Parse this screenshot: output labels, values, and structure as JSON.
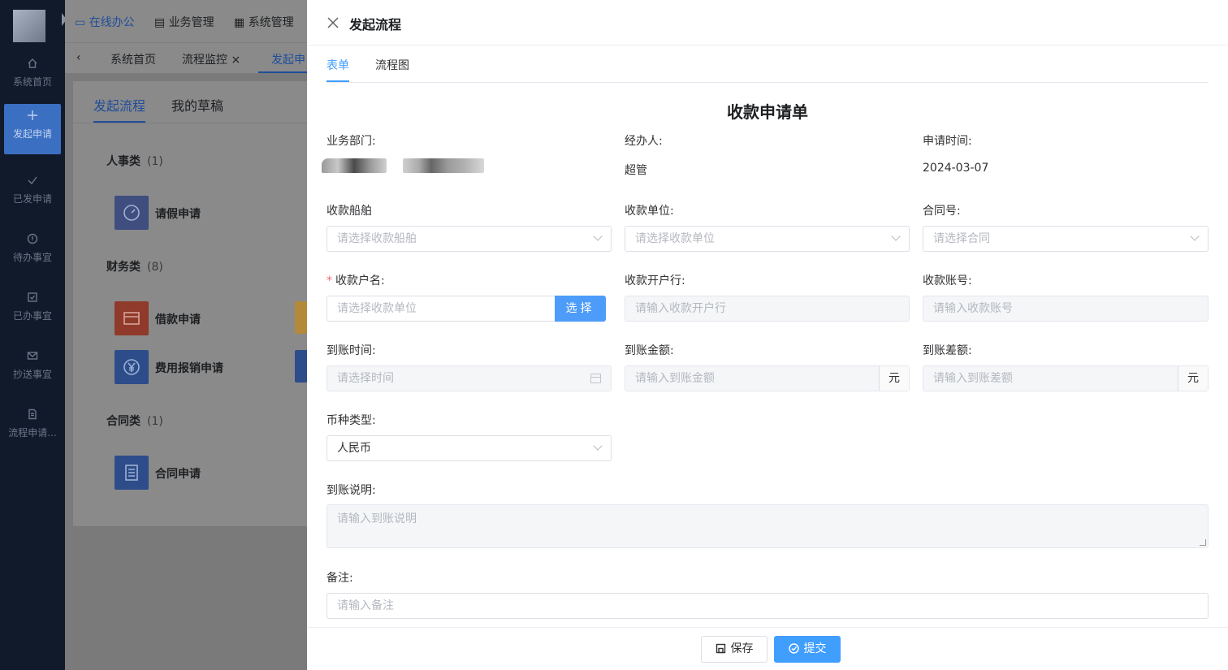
{
  "colors": {
    "primary": "#409eff",
    "sidebar_bg": "#111a2a",
    "sidebar_active": "#3b6fc2",
    "required": "#f56c6c"
  },
  "sidebar": {
    "items": [
      {
        "icon": "home-icon",
        "label": "系统首页"
      },
      {
        "icon": "plus-icon",
        "label": "发起申请"
      },
      {
        "icon": "check-icon",
        "label": "已发申请"
      },
      {
        "icon": "alert-circle-icon",
        "label": "待办事宜"
      },
      {
        "icon": "checkbox-icon",
        "label": "已办事宜"
      },
      {
        "icon": "mail-icon",
        "label": "抄送事宜"
      },
      {
        "icon": "document-icon",
        "label": "流程申请..."
      }
    ]
  },
  "topmenu": {
    "items": [
      {
        "icon": "monitor-icon",
        "label": "在线办公"
      },
      {
        "icon": "list-icon",
        "label": "业务管理"
      },
      {
        "icon": "grid-icon",
        "label": "系统管理"
      }
    ]
  },
  "tabs": {
    "items": [
      "系统首页",
      "流程监控",
      "发起申"
    ]
  },
  "page": {
    "tabs": [
      "发起流程",
      "我的草稿"
    ],
    "categories": [
      {
        "name": "人事类",
        "count": "(1)"
      },
      {
        "name": "财务类",
        "count": "(8)"
      },
      {
        "name": "合同类",
        "count": "(1)"
      }
    ],
    "apps": [
      "请假申请",
      "借款申请",
      "费用报销申请",
      "合同申请"
    ]
  },
  "drawer": {
    "title": "发起流程",
    "tabs": [
      "表单",
      "流程图"
    ],
    "form_title": "收款申请单",
    "fields": {
      "department": {
        "label": "业务部门:"
      },
      "handler": {
        "label": "经办人:",
        "value": "超管"
      },
      "apply_time": {
        "label": "申请时间:",
        "value": "2024-03-07"
      },
      "ship": {
        "label": "收款船舶",
        "placeholder": "请选择收款船舶"
      },
      "unit": {
        "label": "收款单位:",
        "placeholder": "请选择收款单位"
      },
      "contract": {
        "label": "合同号:",
        "placeholder": "请选择合同"
      },
      "account_name": {
        "label": "收款户名:",
        "placeholder": "请选择收款单位",
        "button": "选择"
      },
      "bank": {
        "label": "收款开户行:",
        "placeholder": "请输入收款开户行"
      },
      "account_no": {
        "label": "收款账号:",
        "placeholder": "请输入收款账号"
      },
      "arrival_time": {
        "label": "到账时间:",
        "placeholder": "请选择时间"
      },
      "arrival_amount": {
        "label": "到账金额:",
        "placeholder": "请输入到账金额",
        "suffix": "元"
      },
      "arrival_diff": {
        "label": "到账差额:",
        "placeholder": "请输入到账差额",
        "suffix": "元"
      },
      "currency": {
        "label": "币种类型:",
        "value": "人民币"
      },
      "arrival_note": {
        "label": "到账说明:",
        "placeholder": "请输入到账说明"
      },
      "remark": {
        "label": "备注:",
        "placeholder": "请输入备注"
      }
    },
    "footer": {
      "save": "保存",
      "submit": "提交"
    }
  }
}
